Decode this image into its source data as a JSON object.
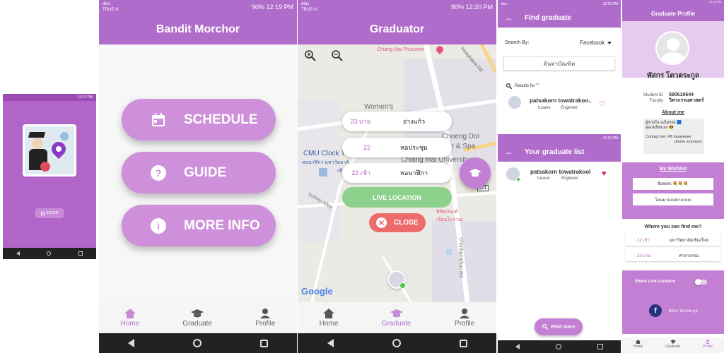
{
  "colors": {
    "accent": "#b06ccb",
    "light": "#ce8fdb",
    "live": "#8cd28c",
    "close": "#ee6b6b"
  },
  "splash": {
    "status_time": "12:23 PM",
    "enter_label": "ENTER"
  },
  "s1": {
    "carrier": "dtac",
    "carrier2": "TRUE-H",
    "battery": "90%",
    "time": "12:19 PM",
    "title": "Bandit Morchor",
    "buttons": [
      "SCHEDULE",
      "GUIDE",
      "MORE INFO"
    ],
    "tabs": [
      "Home",
      "Graduate",
      "Profile"
    ]
  },
  "s2": {
    "carrier": "dtac",
    "carrier2": "TRUE-H",
    "battery": "90%",
    "time": "12:20 PM",
    "title": "Graduator",
    "map_labels": [
      "Chiang Mai Phucome",
      "Huaykaew Rd",
      "Women's",
      "Choeng Doi",
      "ge & Spa",
      "Chiang Mai University",
      "CMU Clock T",
      "หอนาฬิกา มหาวิทยาลั",
      "เชี",
      "Suthep Alley",
      "Chonlaprathan Rd",
      "พิพิธภัณฑ์",
      "เรือนโบราณ",
      "121",
      "Google"
    ],
    "pills": [
      {
        "time": "23 บ่าย",
        "name": "อ่างแก้ว"
      },
      {
        "time": "22",
        "name": "หอประชุม"
      },
      {
        "time": "22 เช้า",
        "name": "หอนาฬิกา"
      }
    ],
    "live_label": "LIVE LOCATION",
    "close_label": "CLOSE",
    "tabs": [
      "Home",
      "Graduate",
      "Profile"
    ]
  },
  "s3": {
    "carrier": "dtac",
    "carrier2": "TRUE-H",
    "time": "12:20 PM",
    "title": "Find graduate",
    "search_by_label": "Search By:",
    "search_by_value": "Facebook",
    "search_placeholder": "ค้นหาบัณฑิต",
    "results_label": "Results for \"\"",
    "result": {
      "name": "patsakorn towatrakoo..",
      "sub": "tusave",
      "role": "Engineer"
    },
    "list_time": "12:20 PM",
    "list_title": "Your graduate list",
    "list_item": {
      "name": "patsakorn towatrakool",
      "sub": "tusave",
      "role": "Engineer"
    },
    "find_more_label": "Find more"
  },
  "s4": {
    "time": "12:18 PM",
    "title": "Graduate Profile",
    "name": "พัสกร โตวตระกูล",
    "student_id_label": "Student ID",
    "student_id": "590610644",
    "faculty_label": "Faculty",
    "faculty": "วิศวกรรมศาสตร์",
    "about_title": "About me",
    "about_line1": "ผู้ชายใจ ฉงไคร่ส่ง 🟦",
    "about_line2": "สุดเจ๋งปิดบอก 😎",
    "about_line3": "Contact me: FB tusaveeiei",
    "about_line4": "phone xxxxxxxx",
    "wishlist_title": "My Wishlist",
    "wishlist": [
      "flowers 💐💐💐",
      "โอนมาแลงค่าแบบบ"
    ],
    "where_title": "Where you can find me?",
    "where": [
      {
        "time": "22 เช้า",
        "place": "มหาวิทยาลัยเชียงใหม่"
      },
      {
        "time": "23 บ่าย",
        "place": "ศาลาธรรม"
      }
    ],
    "share_label": "Share Live Location",
    "fb_name": "พัสกร โตวตระกูล",
    "tabs": [
      "Home",
      "Graduate",
      "Profile"
    ]
  }
}
